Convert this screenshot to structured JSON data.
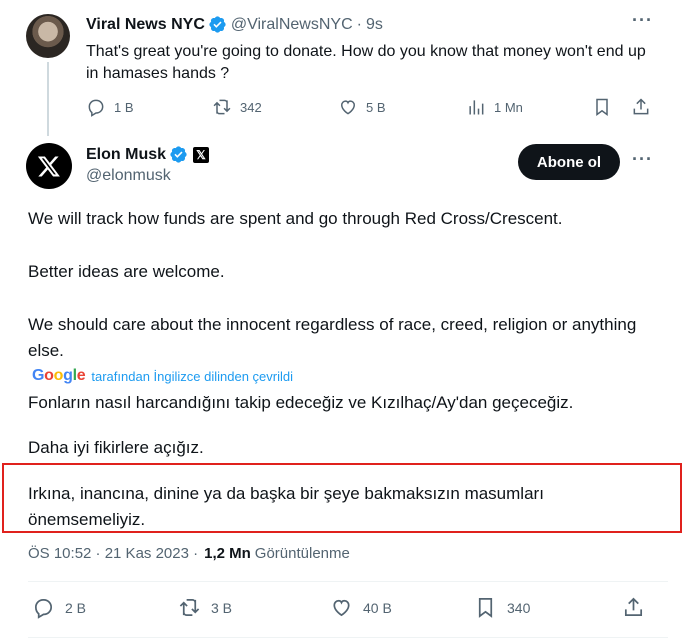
{
  "reply": {
    "name": "Viral News NYC",
    "handle": "@ViralNewsNYC",
    "separator": "·",
    "time": "9s",
    "text": "That's great you're going to donate. How do you know that money won't end up in hamases hands ?",
    "more": "···",
    "actions": {
      "replies": "1 B",
      "reposts": "342",
      "likes": "5 B",
      "views": "1 Mn"
    }
  },
  "tweet": {
    "name": "Elon Musk",
    "badge": "𝕏",
    "handle": "@elonmusk",
    "follow_label": "Abone ol",
    "more": "···",
    "original_paragraphs": [
      "We will track how funds are spent and go through Red Cross/Crescent.",
      "Better ideas are welcome.",
      "We should care about the innocent regardless of race, creed, religion or anything else."
    ],
    "translation_brand": "Google",
    "translation_note": "tarafından İngilizce dilinden çevrildi",
    "translated_paragraphs": [
      "Fonların nasıl harcandığını takip edeceğiz ve Kızılhaç/Ay'dan geçeceğiz.",
      "Daha iyi fikirlere açığız.",
      "Irkına, inancına, dinine ya da başka bir şeye bakmaksızın masumları önemsemeliyiz."
    ],
    "timestamp": "ÖS 10:52 · 21 Kas 2023 ·",
    "views_count": "1,2 Mn",
    "views_label": "Görüntülenme",
    "actions": {
      "replies": "2 B",
      "reposts": "3 B",
      "likes": "40 B",
      "bookmarks": "340"
    }
  },
  "colors": {
    "accent": "#1d9bf0",
    "highlight": "#e0211d",
    "muted": "#536471"
  }
}
